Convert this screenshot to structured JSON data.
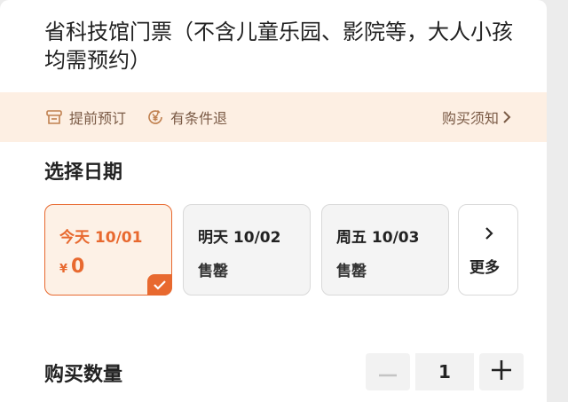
{
  "ticket": {
    "title": "省科技馆门票（不含儿童乐园、影院等，大人小孩均需预约）"
  },
  "notice": {
    "items": [
      {
        "icon": "ticket-icon",
        "label": "提前预订"
      },
      {
        "icon": "yen-refund-icon",
        "label": "有条件退"
      }
    ],
    "link_label": "购买须知",
    "link_icon": "chevron-right-icon"
  },
  "date_section": {
    "title": "选择日期",
    "dates": [
      {
        "label": "今天 10/01",
        "currency": "¥",
        "price": "0",
        "selected": true
      },
      {
        "label": "明天 10/02",
        "status": "售罄",
        "selected": false
      },
      {
        "label": "周五 10/03",
        "status": "售罄",
        "selected": false
      }
    ],
    "more_label": "更多",
    "more_icon": "chevron-right-icon"
  },
  "quantity": {
    "title": "购买数量",
    "value": "1",
    "minus_icon": "minus-icon",
    "plus_icon": "plus-icon"
  },
  "colors": {
    "accent": "#e8692f",
    "notice_bg": "#fdefe3",
    "selected_bg": "#fdf1e6"
  }
}
